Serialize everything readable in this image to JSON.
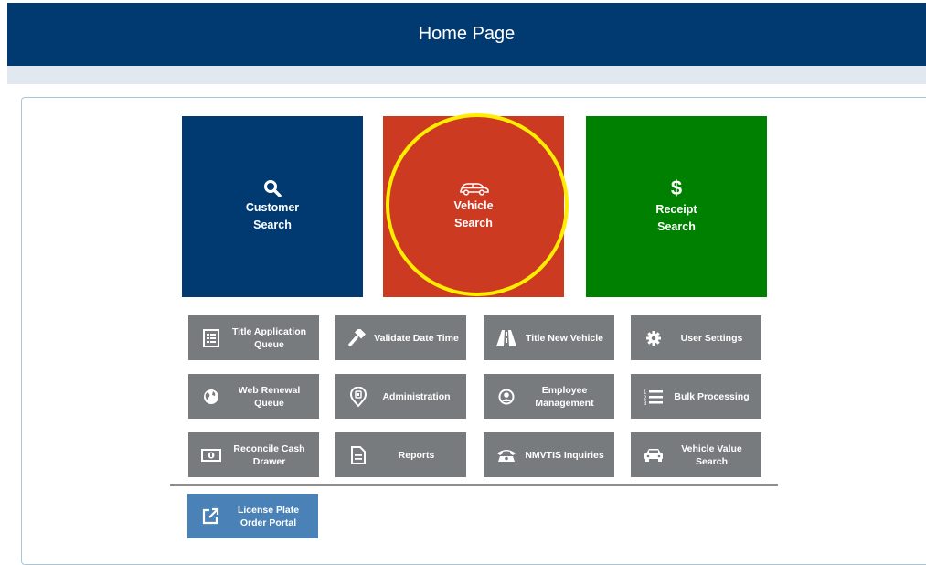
{
  "header": {
    "title": "Home Page"
  },
  "tiles": {
    "customer": {
      "label": "Customer\nSearch",
      "icon": "search-icon",
      "color": "#003a70"
    },
    "vehicle": {
      "label": "Vehicle\nSearch",
      "icon": "car-icon",
      "color": "#cc3a22"
    },
    "receipt": {
      "label": "Receipt\nSearch",
      "icon": "dollar-icon",
      "color": "#008000"
    }
  },
  "buttons": [
    {
      "label": "Title Application\nQueue",
      "icon": "list-icon"
    },
    {
      "label": "Validate Date Time",
      "icon": "gavel-icon"
    },
    {
      "label": "Title New Vehicle",
      "icon": "road-icon"
    },
    {
      "label": "User Settings",
      "icon": "gear-icon"
    },
    {
      "label": "Web Renewal\nQueue",
      "icon": "globe-icon"
    },
    {
      "label": "Administration",
      "icon": "map-pin-icon"
    },
    {
      "label": "Employee\nManagement",
      "icon": "user-circle-icon"
    },
    {
      "label": "Bulk Processing",
      "icon": "numbered-list-icon"
    },
    {
      "label": "Reconcile Cash\nDrawer",
      "icon": "money-icon"
    },
    {
      "label": "Reports",
      "icon": "document-icon"
    },
    {
      "label": "NMVTIS Inquiries",
      "icon": "phone-icon"
    },
    {
      "label": "Vehicle Value\nSearch",
      "icon": "car-icon"
    }
  ],
  "portal_button": {
    "label": "License Plate\nOrder Portal",
    "icon": "external-link-icon"
  },
  "colors": {
    "header": "#003a70",
    "button_gray": "#777b7e",
    "button_blue": "#4a82b7",
    "highlight": "#ffee00"
  }
}
